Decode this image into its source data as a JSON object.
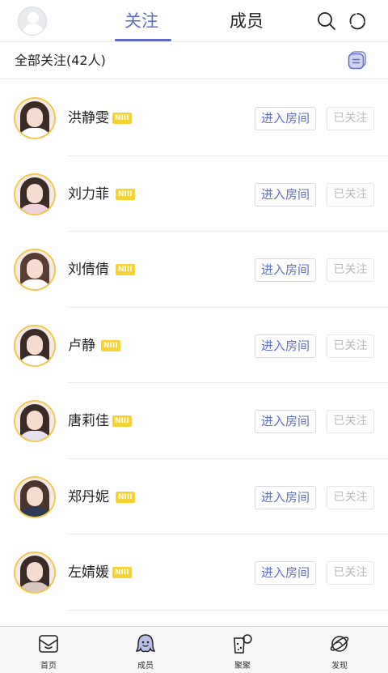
{
  "header": {
    "tabs": [
      {
        "label": "关注",
        "active": true
      },
      {
        "label": "成员",
        "active": false
      }
    ],
    "accent_color": "#5e6ec7"
  },
  "subheader": {
    "title": "全部关注(42人)"
  },
  "members": [
    {
      "name": "洪静雯",
      "team": "NIII",
      "enter_label": "进入房间",
      "followed_label": "已关注"
    },
    {
      "name": "刘力菲",
      "team": "NIII",
      "enter_label": "进入房间",
      "followed_label": "已关注"
    },
    {
      "name": "刘倩倩",
      "team": "NIII",
      "enter_label": "进入房间",
      "followed_label": "已关注"
    },
    {
      "name": "卢静",
      "team": "NIII",
      "enter_label": "进入房间",
      "followed_label": "已关注"
    },
    {
      "name": "唐莉佳",
      "team": "NIII",
      "enter_label": "进入房间",
      "followed_label": "已关注"
    },
    {
      "name": "郑丹妮",
      "team": "NIII",
      "enter_label": "进入房间",
      "followed_label": "已关注"
    },
    {
      "name": "左婧媛",
      "team": "NIII",
      "enter_label": "进入房间",
      "followed_label": "已关注"
    }
  ],
  "bottom_nav": [
    {
      "label": "首页",
      "icon": "home-mail-icon"
    },
    {
      "label": "成员",
      "icon": "members-octopus-icon"
    },
    {
      "label": "聚聚",
      "icon": "gather-cup-icon"
    },
    {
      "label": "发现",
      "icon": "discover-planet-icon"
    }
  ],
  "colors": {
    "badge": "#f6d233",
    "avatar_ring": "#f2c94c"
  }
}
